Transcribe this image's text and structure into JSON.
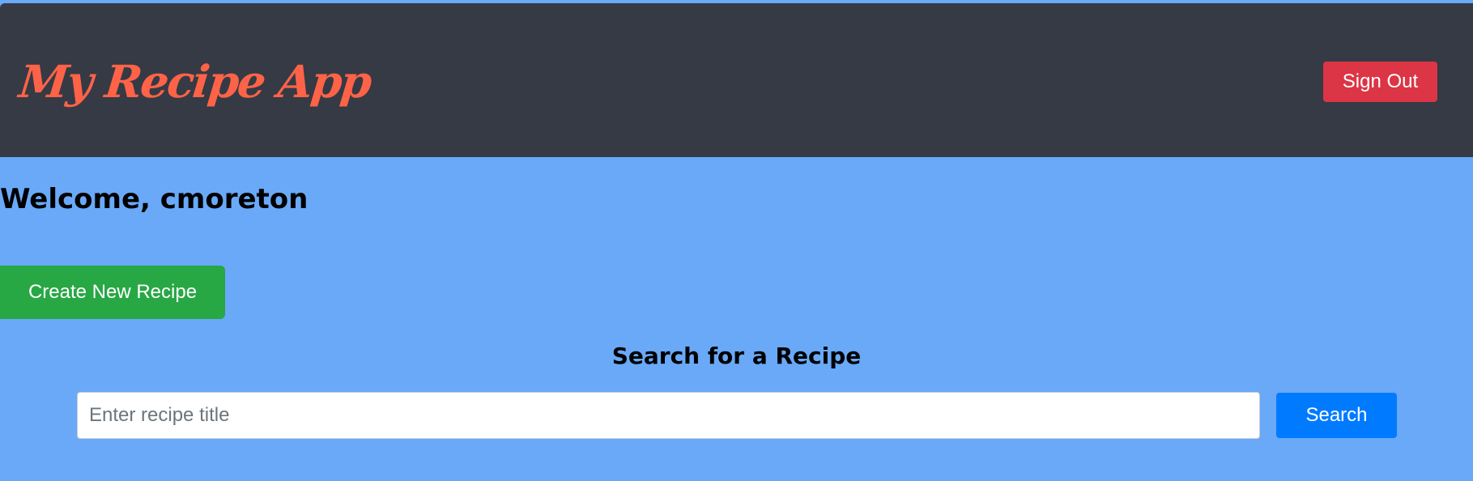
{
  "header": {
    "app_title": "My Recipe App",
    "sign_out_label": "Sign Out"
  },
  "main": {
    "welcome_text": "Welcome, cmoreton",
    "create_button_label": "Create New Recipe"
  },
  "search": {
    "heading": "Search for a Recipe",
    "placeholder": "Enter recipe title",
    "value": "",
    "button_label": "Search"
  },
  "colors": {
    "header_background": "#353a45",
    "page_background": "#69a9f8",
    "brand_title": "#ff6347",
    "sign_out_button": "#dc3545",
    "create_button": "#28a745",
    "search_button": "#007bff"
  }
}
